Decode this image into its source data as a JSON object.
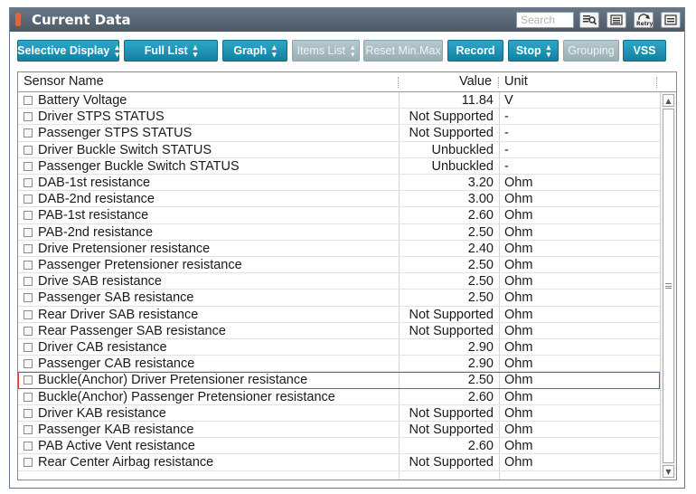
{
  "window": {
    "title": "Current Data",
    "search_placeholder": "Search",
    "icons": [
      "search-list-icon",
      "list-icon",
      "retry-icon",
      "menu-icon"
    ],
    "retry_label": "Retry"
  },
  "toolbar": {
    "buttons": [
      {
        "label": "Selective Display",
        "spinner": true,
        "enabled": true
      },
      {
        "label": "Full List",
        "spinner": true,
        "enabled": true
      },
      {
        "label": "Graph",
        "spinner": true,
        "enabled": true
      },
      {
        "label": "Items List",
        "spinner": true,
        "enabled": false
      },
      {
        "label": "Reset Min.Max",
        "spinner": false,
        "enabled": false
      },
      {
        "label": "Record",
        "spinner": false,
        "enabled": true
      },
      {
        "label": "Stop",
        "spinner": true,
        "enabled": true
      },
      {
        "label": "Grouping",
        "spinner": false,
        "enabled": false
      },
      {
        "label": "VSS",
        "spinner": false,
        "enabled": true
      }
    ]
  },
  "grid": {
    "columns": {
      "name": "Sensor Name",
      "value": "Value",
      "unit": "Unit"
    },
    "selected_row": 17,
    "rows": [
      {
        "name": "Battery Voltage",
        "value": "11.84",
        "unit": "V"
      },
      {
        "name": "Driver STPS STATUS",
        "value": "Not Supported",
        "unit": "-"
      },
      {
        "name": "Passenger STPS STATUS",
        "value": "Not Supported",
        "unit": "-"
      },
      {
        "name": "Driver Buckle Switch STATUS",
        "value": "Unbuckled",
        "unit": "-"
      },
      {
        "name": "Passenger Buckle Switch STATUS",
        "value": "Unbuckled",
        "unit": "-"
      },
      {
        "name": "DAB-1st resistance",
        "value": "3.20",
        "unit": "Ohm"
      },
      {
        "name": "DAB-2nd resistance",
        "value": "3.00",
        "unit": "Ohm"
      },
      {
        "name": "PAB-1st resistance",
        "value": "2.60",
        "unit": "Ohm"
      },
      {
        "name": "PAB-2nd resistance",
        "value": "2.50",
        "unit": "Ohm"
      },
      {
        "name": "Drive Pretensioner resistance",
        "value": "2.40",
        "unit": "Ohm"
      },
      {
        "name": "Passenger Pretensioner resistance",
        "value": "2.50",
        "unit": "Ohm"
      },
      {
        "name": "Drive SAB resistance",
        "value": "2.50",
        "unit": "Ohm"
      },
      {
        "name": "Passenger SAB resistance",
        "value": "2.50",
        "unit": "Ohm"
      },
      {
        "name": "Rear Driver SAB resistance",
        "value": "Not Supported",
        "unit": "Ohm"
      },
      {
        "name": "Rear Passenger SAB resistance",
        "value": "Not Supported",
        "unit": "Ohm"
      },
      {
        "name": "Driver CAB resistance",
        "value": "2.90",
        "unit": "Ohm"
      },
      {
        "name": "Passenger CAB resistance",
        "value": "2.90",
        "unit": "Ohm"
      },
      {
        "name": "Buckle(Anchor) Driver Pretensioner resistance",
        "value": "2.50",
        "unit": "Ohm"
      },
      {
        "name": "Buckle(Anchor) Passenger Pretensioner resistance",
        "value": "2.60",
        "unit": "Ohm"
      },
      {
        "name": "Driver KAB resistance",
        "value": "Not Supported",
        "unit": "Ohm"
      },
      {
        "name": "Passenger KAB resistance",
        "value": "Not Supported",
        "unit": "Ohm"
      },
      {
        "name": "PAB Active Vent resistance",
        "value": "2.60",
        "unit": "Ohm"
      },
      {
        "name": "Rear Center Airbag resistance",
        "value": "Not Supported",
        "unit": "Ohm"
      }
    ]
  },
  "colors": {
    "titlebar": "#5a6878",
    "button": "#1d92b3",
    "button_disabled": "#a9bcc2",
    "selection_outline": "#e03b2f"
  }
}
